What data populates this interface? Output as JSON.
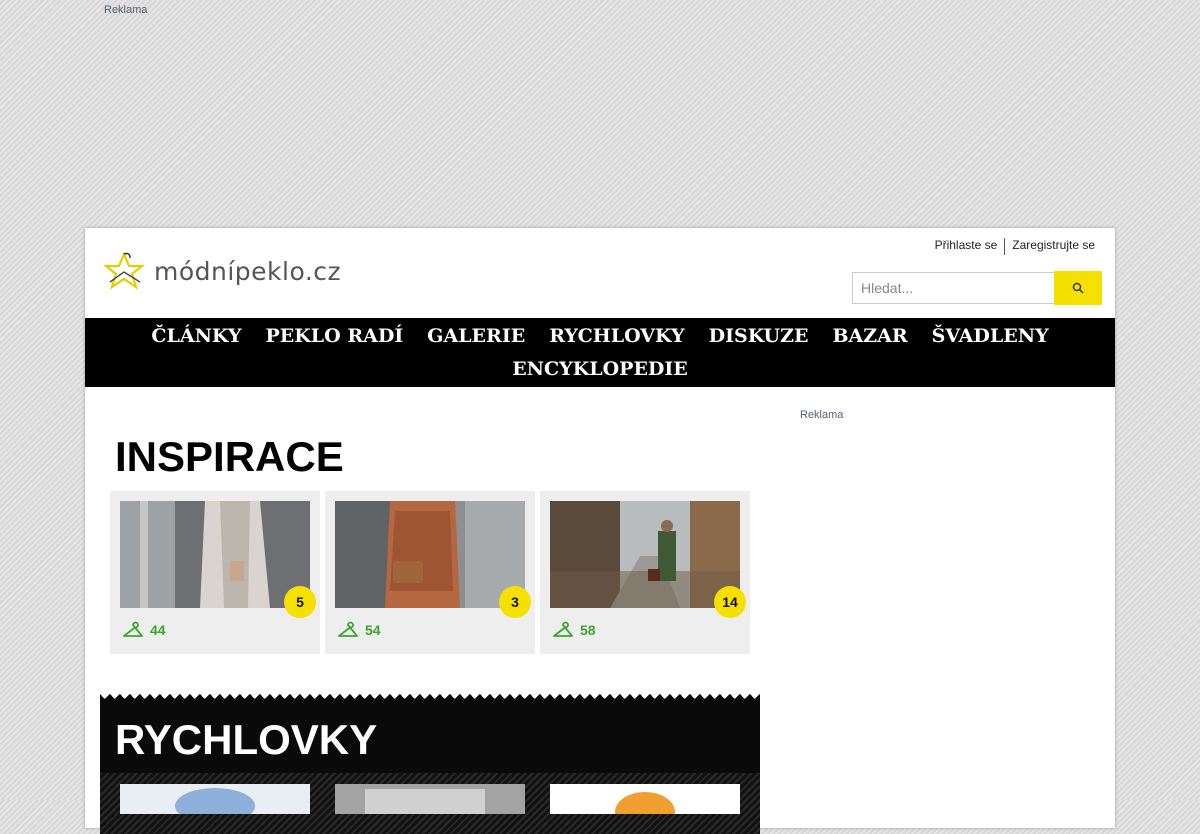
{
  "ads": {
    "top_label": "Reklama",
    "side_label": "Reklama"
  },
  "header": {
    "logo_text": "módnípeklo.cz",
    "login": "Přihlaste se",
    "register": "Zaregistrujte se",
    "search_placeholder": "Hledat..."
  },
  "nav": {
    "items": [
      "ČLÁNKY",
      "PEKLO RADÍ",
      "GALERIE",
      "RYCHLOVKY",
      "DISKUZE",
      "BAZAR",
      "ŠVADLENY",
      "ENCYKLOPEDIE"
    ]
  },
  "inspirace": {
    "title": "INSPIRACE",
    "cards": [
      {
        "badge": "5",
        "likes": "44"
      },
      {
        "badge": "3",
        "likes": "54"
      },
      {
        "badge": "14",
        "likes": "58"
      }
    ]
  },
  "rychlovky": {
    "title": "RYCHLOVKY"
  },
  "colors": {
    "accent": "#f5e000",
    "nav_bg": "#000000",
    "likes": "#3aa52c"
  }
}
